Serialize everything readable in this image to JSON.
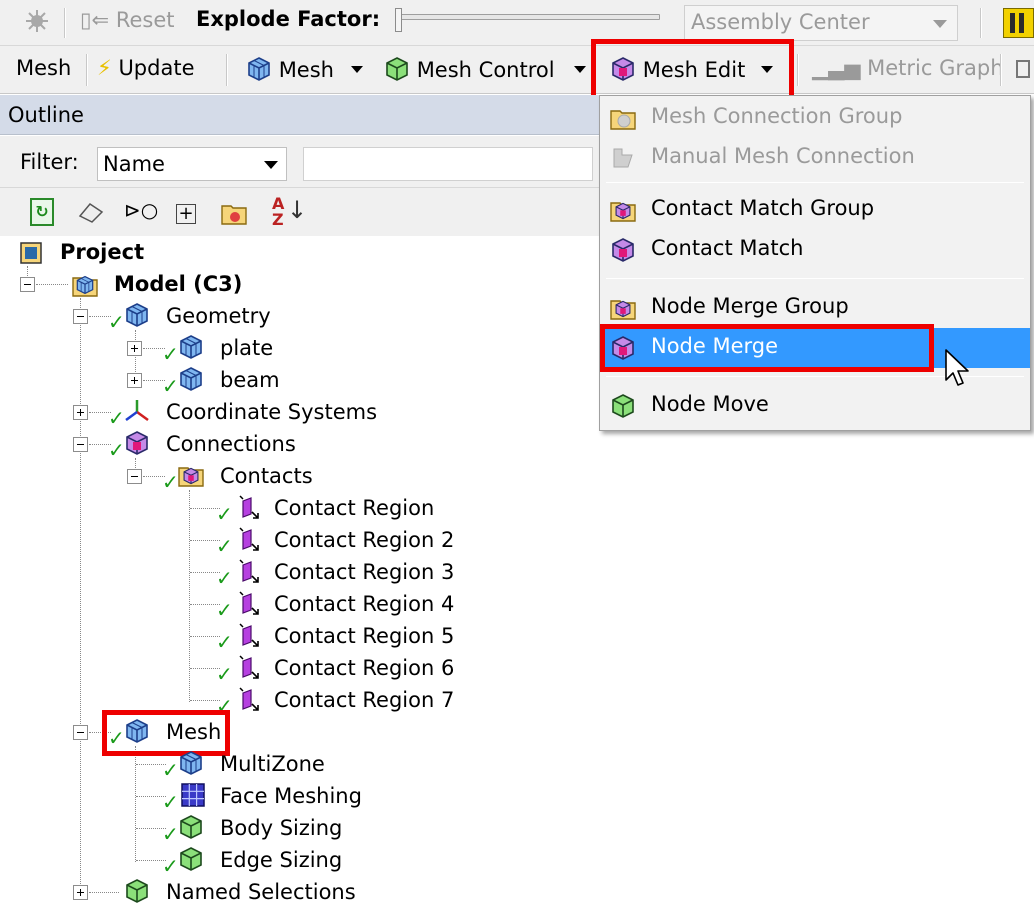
{
  "toolbar_top": {
    "reset_label": "Reset",
    "explode_factor_label": "Explode Factor:",
    "assembly_combo_value": "Assembly Center"
  },
  "toolbar_mesh": {
    "mesh_label": "Mesh",
    "update_label": "Update",
    "mesh_dropdown_label": "Mesh",
    "mesh_control_label": "Mesh Control",
    "mesh_edit_label": "Mesh Edit",
    "metric_graph_label": "Metric Graph"
  },
  "outline": {
    "title": "Outline",
    "filter_label": "Filter:",
    "filter_value": "Name",
    "filter_text": ""
  },
  "tree": {
    "project": "Project",
    "model": "Model (C3)",
    "geometry": "Geometry",
    "plate": "plate",
    "beam": "beam",
    "coordinate_systems": "Coordinate Systems",
    "connections": "Connections",
    "contacts": "Contacts",
    "contact_regions": [
      "Contact Region",
      "Contact Region 2",
      "Contact Region 3",
      "Contact Region 4",
      "Contact Region 5",
      "Contact Region 6",
      "Contact Region 7"
    ],
    "mesh": "Mesh",
    "multizone": "MultiZone",
    "face_meshing": "Face Meshing",
    "body_sizing": "Body Sizing",
    "edge_sizing": "Edge Sizing",
    "named_selections": "Named Selections"
  },
  "menu": {
    "items": [
      "Mesh Connection Group",
      "Manual Mesh Connection",
      "Contact Match Group",
      "Contact Match",
      "Node Merge Group",
      "Node Merge",
      "Node Move"
    ]
  },
  "colors": {
    "highlight": "#3399ff",
    "annotation_red": "#ee0000",
    "check_green": "#1a9a1a"
  }
}
